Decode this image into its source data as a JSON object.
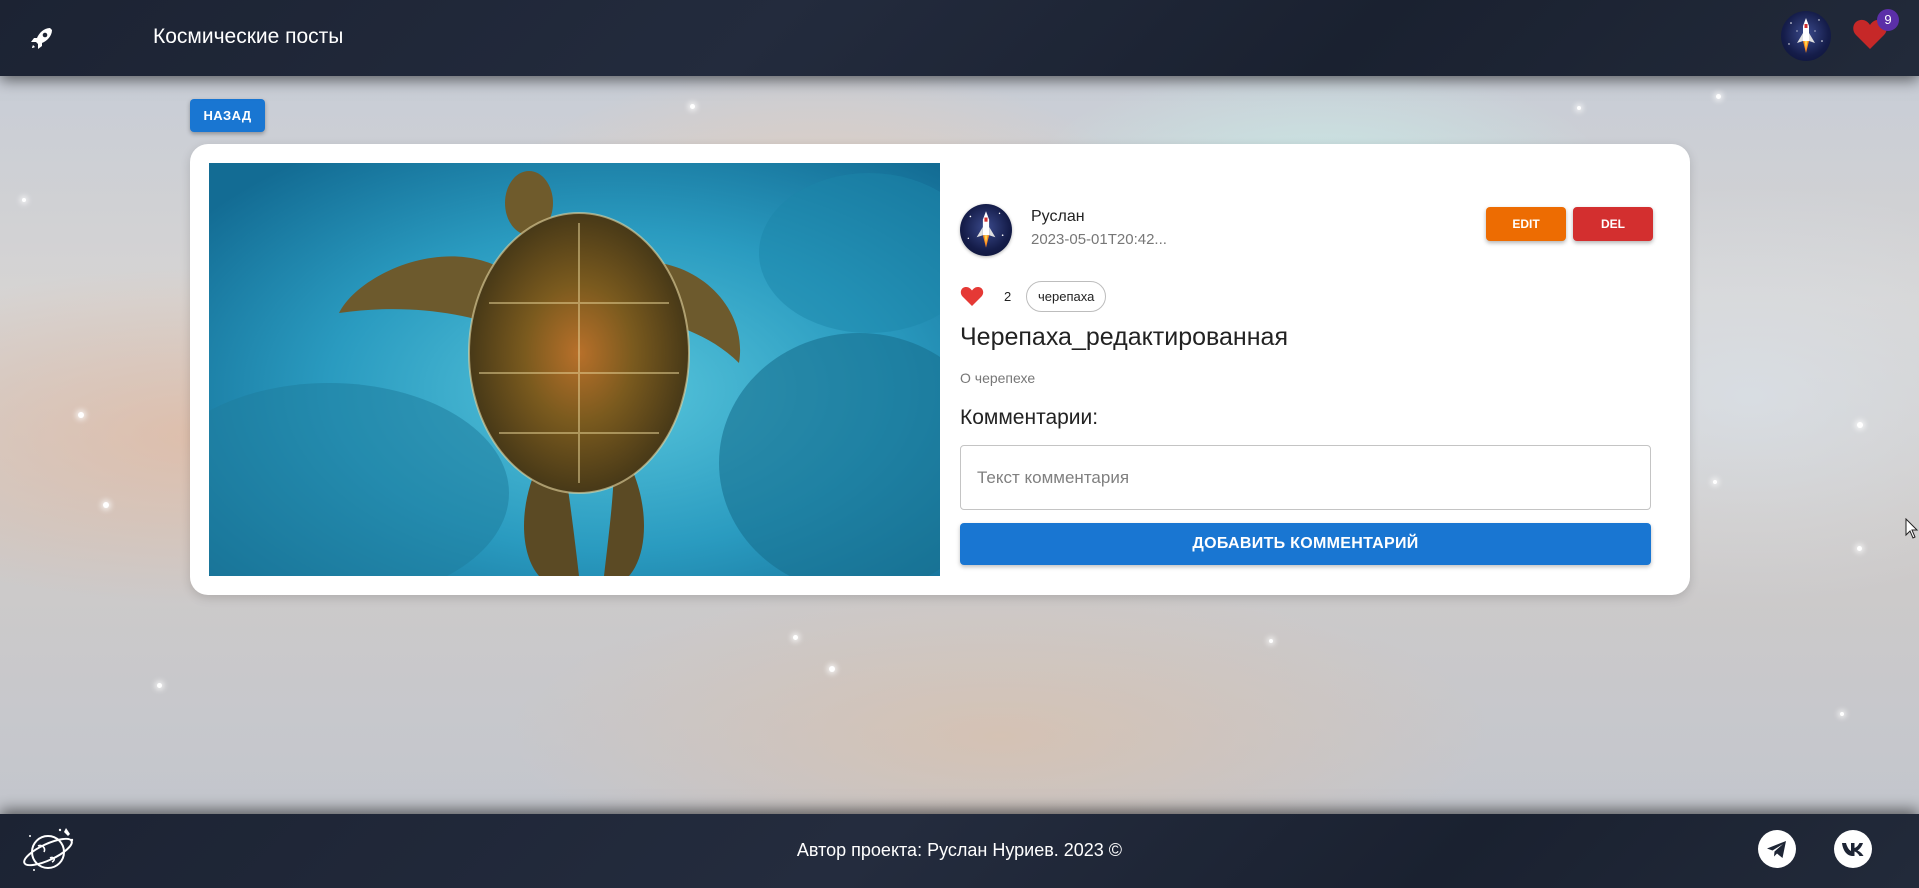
{
  "header": {
    "title": "Космические посты",
    "favorites_count": "9",
    "icons": [
      "rocket-icon",
      "avatar",
      "heart-icon"
    ]
  },
  "navigation": {
    "back_label": "НАЗАД"
  },
  "post": {
    "author": "Руслан",
    "date": "2023-05-01T20:42...",
    "edit_label": "EDIT",
    "delete_label": "DEL",
    "likes": "2",
    "tag": "черепаха",
    "title": "Черепаха_редактированная",
    "description": "О черепехе"
  },
  "comments": {
    "heading": "Комментарии:",
    "input_placeholder": "Текст комментария",
    "input_value": "",
    "submit_label": "ДОБАВИТЬ КОММЕНТАРИЙ"
  },
  "footer": {
    "copyright": "Автор проекта: Руслан Нуриев. 2023 ©",
    "social": [
      "telegram-icon",
      "vk-icon"
    ]
  },
  "colors": {
    "primary": "#1976d2",
    "edit": "#ed6c02",
    "delete": "#d32f2f",
    "heart": "#d32f2f",
    "badge": "#5b2fa8",
    "header_bg": "#1e2535"
  }
}
